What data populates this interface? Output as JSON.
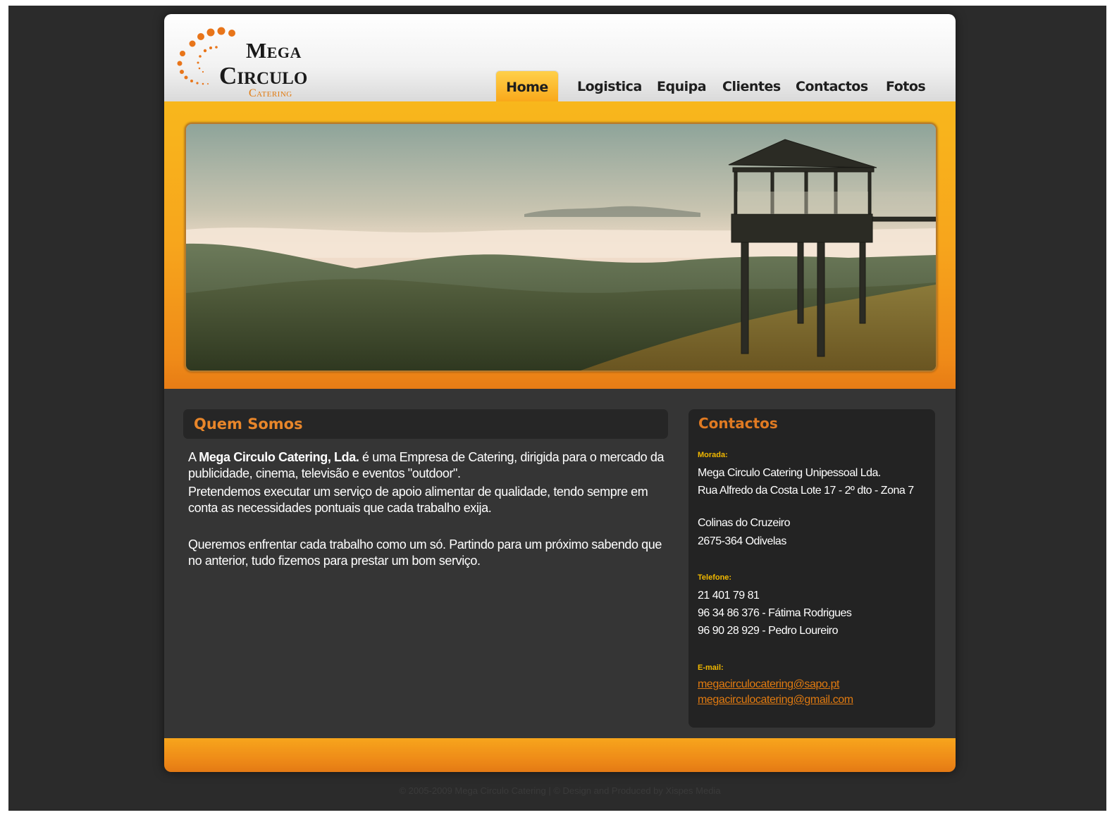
{
  "logo": {
    "line1": "Mega",
    "line2": "Circulo",
    "line3": "Catering",
    "dot_color": "#e8751a"
  },
  "nav": {
    "items": [
      {
        "label": "Home",
        "active": true
      },
      {
        "label": "Logistica",
        "active": false
      },
      {
        "label": "Equipa",
        "active": false
      },
      {
        "label": "Clientes",
        "active": false
      },
      {
        "label": "Contactos",
        "active": false
      },
      {
        "label": "Fotos",
        "active": false
      }
    ]
  },
  "banner": {
    "image_icon": "landscape-photo"
  },
  "about": {
    "title": "Quem Somos",
    "p1_prefix": "A ",
    "p1_company": "Mega Circulo Catering, Lda.",
    "p1_rest": " é uma Empresa de Catering, dirigida para o mercado da publicidade, cinema, televisão e eventos \"outdoor\".",
    "p2": "Pretendemos executar um serviço de apoio alimentar de qualidade, tendo sempre em conta as necessidades pontuais que cada trabalho exija.",
    "p3": "Queremos enfrentar cada trabalho como um só. Partindo para um próximo sabendo que no anterior, tudo fizemos para prestar um bom serviço."
  },
  "contacts": {
    "title": "Contactos",
    "address_label": "Morada:",
    "address_line1": "Mega Circulo Catering Unipessoal Lda.",
    "address_line2": "Rua Alfredo da Costa Lote 17 - 2º dto - Zona 7",
    "address_line3": "Colinas do Cruzeiro",
    "address_line4": "2675-364 Odivelas",
    "phone_label": "Telefone:",
    "phone1": "21 401 79 81",
    "phone2": "96 34 86 376 - Fátima Rodrigues",
    "phone3": "96 90 28 929 - Pedro Loureiro",
    "email_label": "E-mail:",
    "email1": "megacirculocatering@sapo.pt",
    "email2": "megacirculocatering@gmail.com"
  },
  "footer": {
    "copyright": "© 2005-2009 Mega Circulo Catering | © Design and Produced by Xispes Media"
  },
  "colors": {
    "accent_orange": "#f7a51c",
    "title_orange": "#e8862a",
    "label_yellow": "#f1b800",
    "content_bg": "#353535"
  }
}
